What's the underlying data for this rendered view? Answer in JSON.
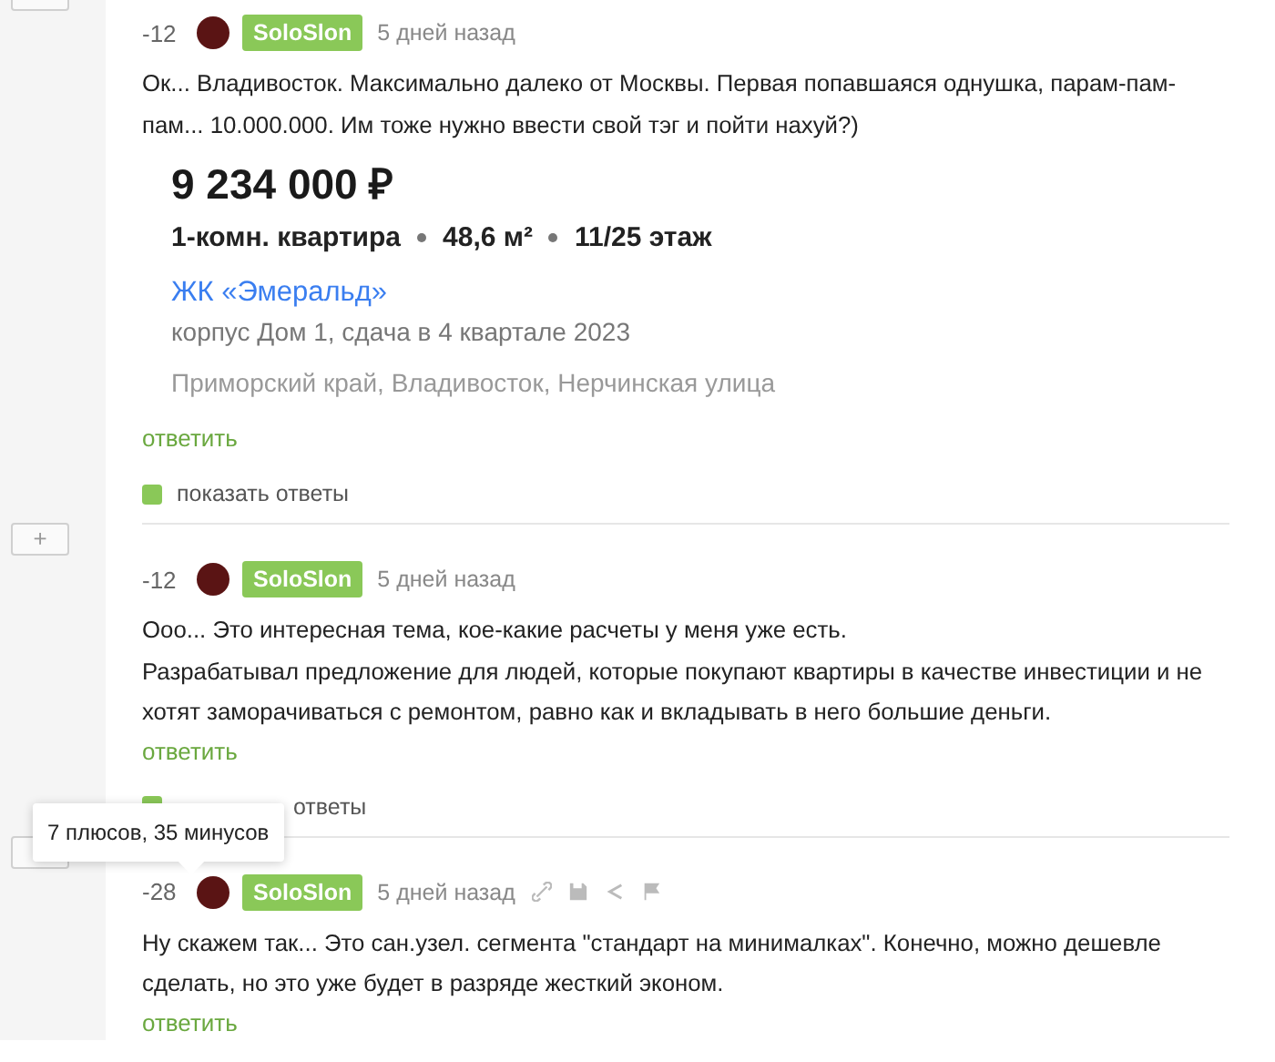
{
  "comments": [
    {
      "score": "-12",
      "author": "SoloSlon",
      "time": "5 дней назад",
      "show_actions": false,
      "paragraphs": [
        "Ок... Владивосток. Максимально далеко от Москвы. Первая попавшаяся однушка, парам-пам-пам... 10.000.000. Им тоже нужно ввести свой тэг и пойти нахуй?)"
      ],
      "listing": {
        "price": "9 234 000 ₽",
        "specs": [
          "1-комн. квартира",
          "48,6 м²",
          "11/25 этаж"
        ],
        "complex": "ЖК «Эмеральд»",
        "building": "корпус Дом 1, сдача в 4 квартале 2023",
        "address": "Приморский край, Владивосток, Нерчинская улица"
      },
      "reply": "ответить",
      "show_replies": {
        "text": "показать ответы",
        "covered": false
      }
    },
    {
      "toggle_label": "+",
      "score": "-12",
      "author": "SoloSlon",
      "time": "5 дней назад",
      "show_actions": false,
      "paragraphs": [
        "Ооо... Это интересная тема, кое-какие расчеты у меня уже есть.",
        "Разрабатывал предложение для людей, которые покупают квартиры в качестве инвестиции и не хотят заморачиваться с ремонтом, равно как и вкладывать в него большие деньги."
      ],
      "reply": "ответить",
      "show_replies": {
        "text": "ответы",
        "covered": true
      }
    },
    {
      "score": "-28",
      "author": "SoloSlon",
      "time": "5 дней назад",
      "show_actions": true,
      "paragraphs": [
        "Ну скажем так... Это сан.узел. сегмента \"стандарт на минималках\". Конечно, можно дешевле сделать, но это уже будет в разряде жесткий эконом."
      ],
      "reply": "ответить"
    }
  ],
  "tooltip": {
    "text": "7 плюсов, 35 минусов"
  }
}
